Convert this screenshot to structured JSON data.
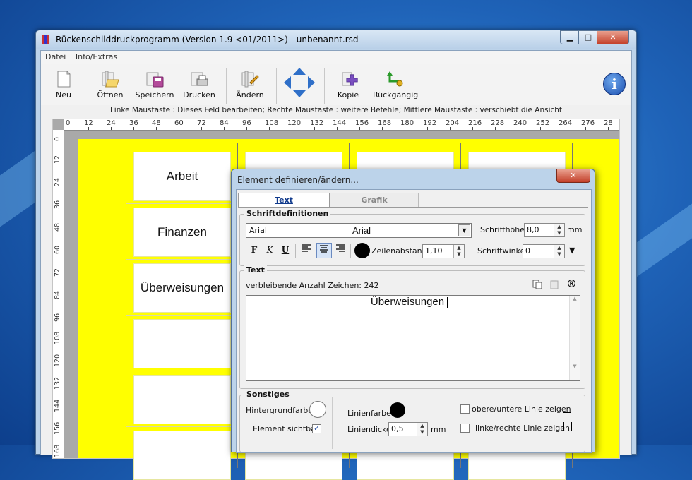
{
  "window": {
    "title": "Rückenschilddruckprogramm (Version 1.9 <01/2011>) - unbenannt.rsd",
    "min_glyph": "▁",
    "max_glyph": "□",
    "close_glyph": "✕"
  },
  "menu": [
    "Datei",
    "Info/Extras"
  ],
  "toolbar": {
    "neu": "Neu",
    "oeffnen": "Öffnen",
    "speichern": "Speichern",
    "drucken": "Drucken",
    "aendern": "Ändern",
    "kopie": "Kopie",
    "rueckgaengig": "Rückgängig",
    "info_glyph": "i"
  },
  "hint": "Linke Maustaste : Dieses Feld bearbeiten;  Rechte Maustaste : weitere Befehle;  Mittlere Maustaste : verschiebt die Ansicht",
  "ruler": {
    "h": [
      "0",
      "12",
      "24",
      "36",
      "48",
      "60",
      "72",
      "84",
      "96",
      "108",
      "120",
      "132",
      "144",
      "156",
      "168",
      "180",
      "192",
      "204",
      "216",
      "228",
      "240",
      "252",
      "264",
      "276",
      "28"
    ],
    "v": [
      "0",
      "12",
      "24",
      "36",
      "48",
      "60",
      "72",
      "84",
      "96",
      "108",
      "120",
      "132",
      "144",
      "156",
      "168"
    ]
  },
  "labels": [
    "Arbeit",
    "Finanzen",
    "Überweisungen",
    "",
    "",
    ""
  ],
  "dialog": {
    "title": "Element definieren/ändern...",
    "close_glyph": "✕",
    "tab_text": "Text",
    "tab_grafik": "Grafik",
    "schrift": {
      "group_label": "Schriftdefinitionen",
      "font_left": "Arial",
      "font_center": "Arial",
      "hoehe_label": "Schrifthöhe",
      "hoehe_value": "8,0",
      "hoehe_unit": "mm",
      "bold": "F",
      "italic": "K",
      "underline": "U",
      "zeilenabstand_label": "Zeilenabstand",
      "zeilenabstand_value": "1,10",
      "winkel_label": "Schriftwinkel",
      "winkel_value": "0"
    },
    "text": {
      "group_label": "Text",
      "remaining": "verbleibende Anzahl Zeichen: 242",
      "content": "Überweisungen",
      "registered_glyph": "®"
    },
    "sonstiges": {
      "group_label": "Sonstiges",
      "hintergrund": "Hintergrundfarbe",
      "sichtbar": "Element sichtbar",
      "sichtbar_checked": true,
      "check_glyph": "✓",
      "linienfarbe": "Linienfarbe",
      "liniendicke": "Liniendicke",
      "liniendicke_value": "0,5",
      "liniendicke_unit": "mm",
      "oben_unten": "obere/untere Linie zeigen",
      "links_rechts": "linke/rechte Linie zeigen"
    }
  },
  "colors": {
    "paper": "#ffff00",
    "desktop": "#1f63b8",
    "accent": "#2f6fc8"
  }
}
